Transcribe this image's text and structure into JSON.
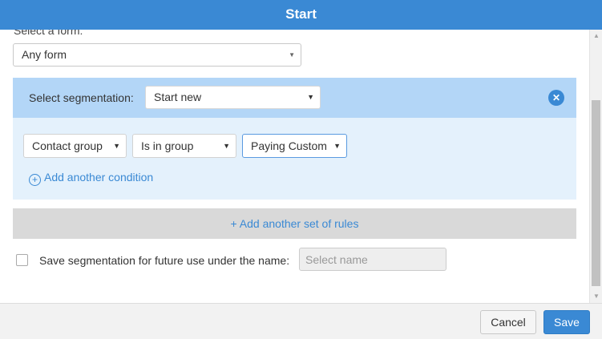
{
  "window": {
    "title": "Start"
  },
  "form": {
    "label": "Select a form:",
    "selected": "Any form"
  },
  "segmentation": {
    "label": "Select segmentation:",
    "selected": "Start new",
    "close_icon": "close-circle-icon"
  },
  "conditions": [
    {
      "value": "Contact group"
    },
    {
      "value": "Is in group"
    },
    {
      "value": "Paying Custom"
    }
  ],
  "add_condition": {
    "icon": "plus-circle-icon",
    "label": "Add another condition"
  },
  "add_set": {
    "label": "+ Add another set of rules"
  },
  "save_segmentation": {
    "label": "Save segmentation for future use under the name:",
    "placeholder": "Select name",
    "checked": false
  },
  "footer": {
    "cancel_label": "Cancel",
    "save_label": "Save"
  },
  "colors": {
    "accent": "#3a89d4",
    "segmentation_header": "#b3d6f7",
    "conditions_bg": "#e4f1fc",
    "add_set_bg": "#d9d9d9"
  }
}
